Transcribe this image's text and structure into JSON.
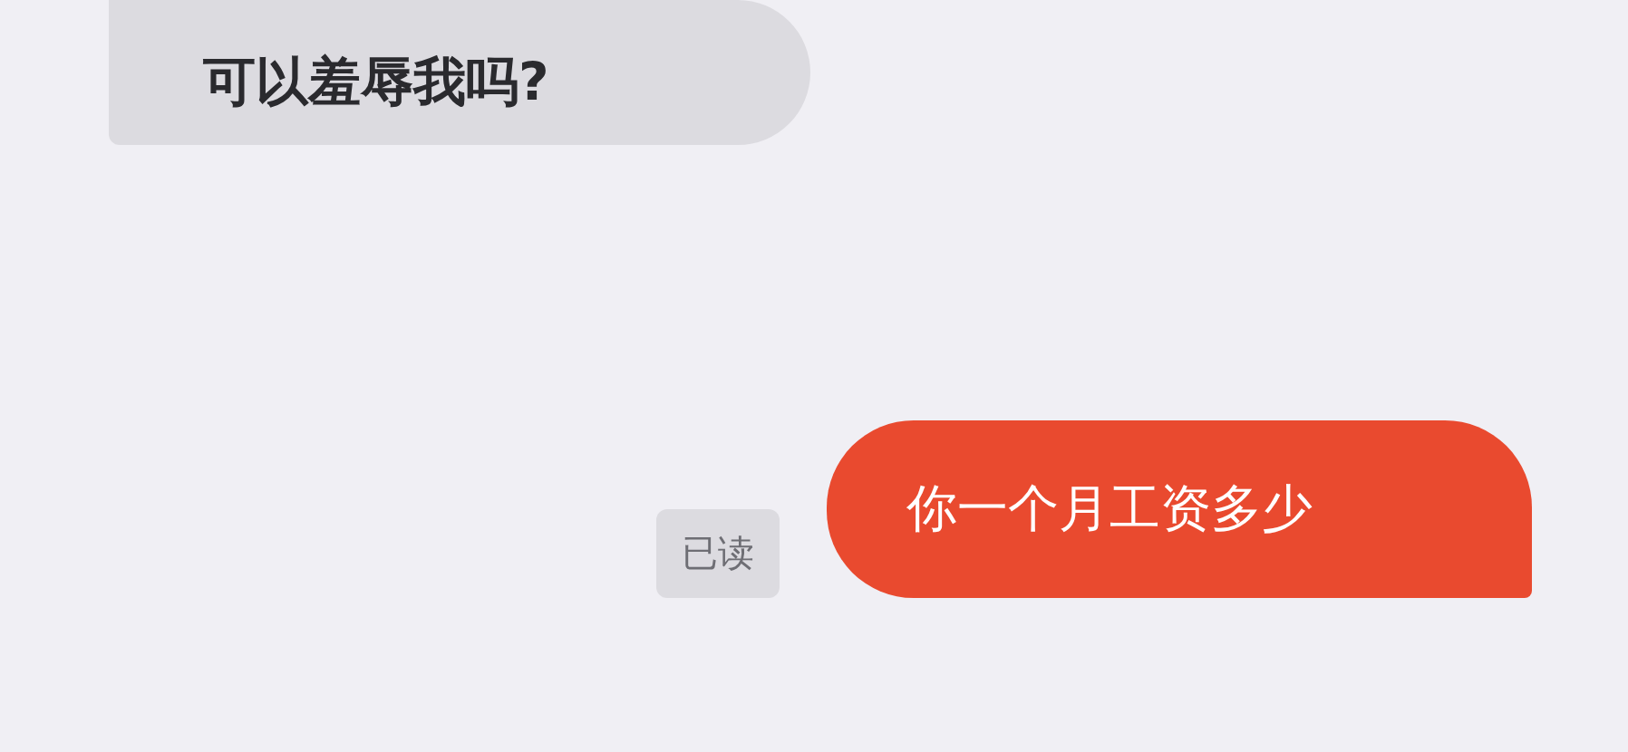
{
  "messages": [
    {
      "kind": "incoming",
      "text": "可以羞辱我吗?"
    },
    {
      "kind": "outgoing",
      "text": "你一个月工资多少",
      "read_label": "已读"
    }
  ]
}
